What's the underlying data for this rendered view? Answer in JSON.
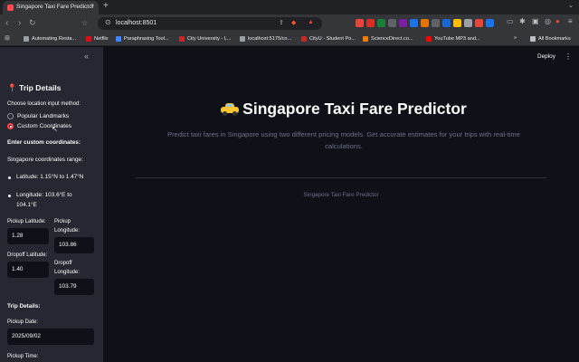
{
  "browser": {
    "tab_title": "Singapore Taxi Fare Predictor",
    "tab_close": "×",
    "new_tab": "+",
    "url": "localhost:8501",
    "bookmarks": [
      {
        "label": "Automating Resta...",
        "color": "#9aa0a6"
      },
      {
        "label": "Netflix",
        "color": "#e50914"
      },
      {
        "label": "Paraphrasing Tool...",
        "color": "#4285f4"
      },
      {
        "label": "City University - L...",
        "color": "#c62828"
      },
      {
        "label": "localhost:5175/co...",
        "color": "#9aa0a6"
      },
      {
        "label": "CityU - Student Po...",
        "color": "#c62828"
      },
      {
        "label": "ScienceDirect.co...",
        "color": "#f57c00"
      },
      {
        "label": "YouTube MP3 and...",
        "color": "#ff0000"
      }
    ],
    "more_bookmarks": "»",
    "all_bookmarks": "All Bookmarks"
  },
  "sidebar": {
    "collapse_icon": "«",
    "heading": "📍 Trip Details",
    "input_method_label": "Choose location input method:",
    "options": [
      "Popular Landmarks",
      "Custom Coordinates"
    ],
    "selected_option": "Custom Coordinates",
    "custom_heading": "Enter custom coordinates:",
    "range_label": "Singapore coordinates range:",
    "lat_range": "Latitude: 1.15°N to 1.47°N",
    "lng_range_1": "Longitude: 103.6°E to",
    "lng_range_2": "104.1°E",
    "pickup_lat_label": "Pickup Latitude:",
    "pickup_lat_value": "1.28",
    "pickup_lng_label_1": "Pickup",
    "pickup_lng_label_2": "Longitude:",
    "pickup_lng_value": "103.86",
    "dropoff_lat_label": "Dropoff Latitude:",
    "dropoff_lat_value": "1.40",
    "dropoff_lng_label_1": "Dropoff",
    "dropoff_lng_label_2": "Longitude:",
    "dropoff_lng_value": "103.79",
    "trip_details_heading": "Trip Details:",
    "pickup_date_label": "Pickup Date:",
    "pickup_date_value": "2025/09/02",
    "pickup_time_label": "Pickup Time:"
  },
  "main": {
    "deploy_label": "Deploy",
    "menu_icon": "⋮",
    "title": "Singapore Taxi Fare Predictor",
    "subtitle_line1": "Predict taxi fares in Singapore using two different pricing models. Get accurate estimates for your trips with real-time",
    "subtitle_line2": "calculations.",
    "footer": "Singapore Taxi Fare Predictor"
  },
  "colors": {
    "accent": "#ff4b4b",
    "background": "#0e1117",
    "sidebar": "#262730",
    "muted_text": "#6d7287"
  }
}
